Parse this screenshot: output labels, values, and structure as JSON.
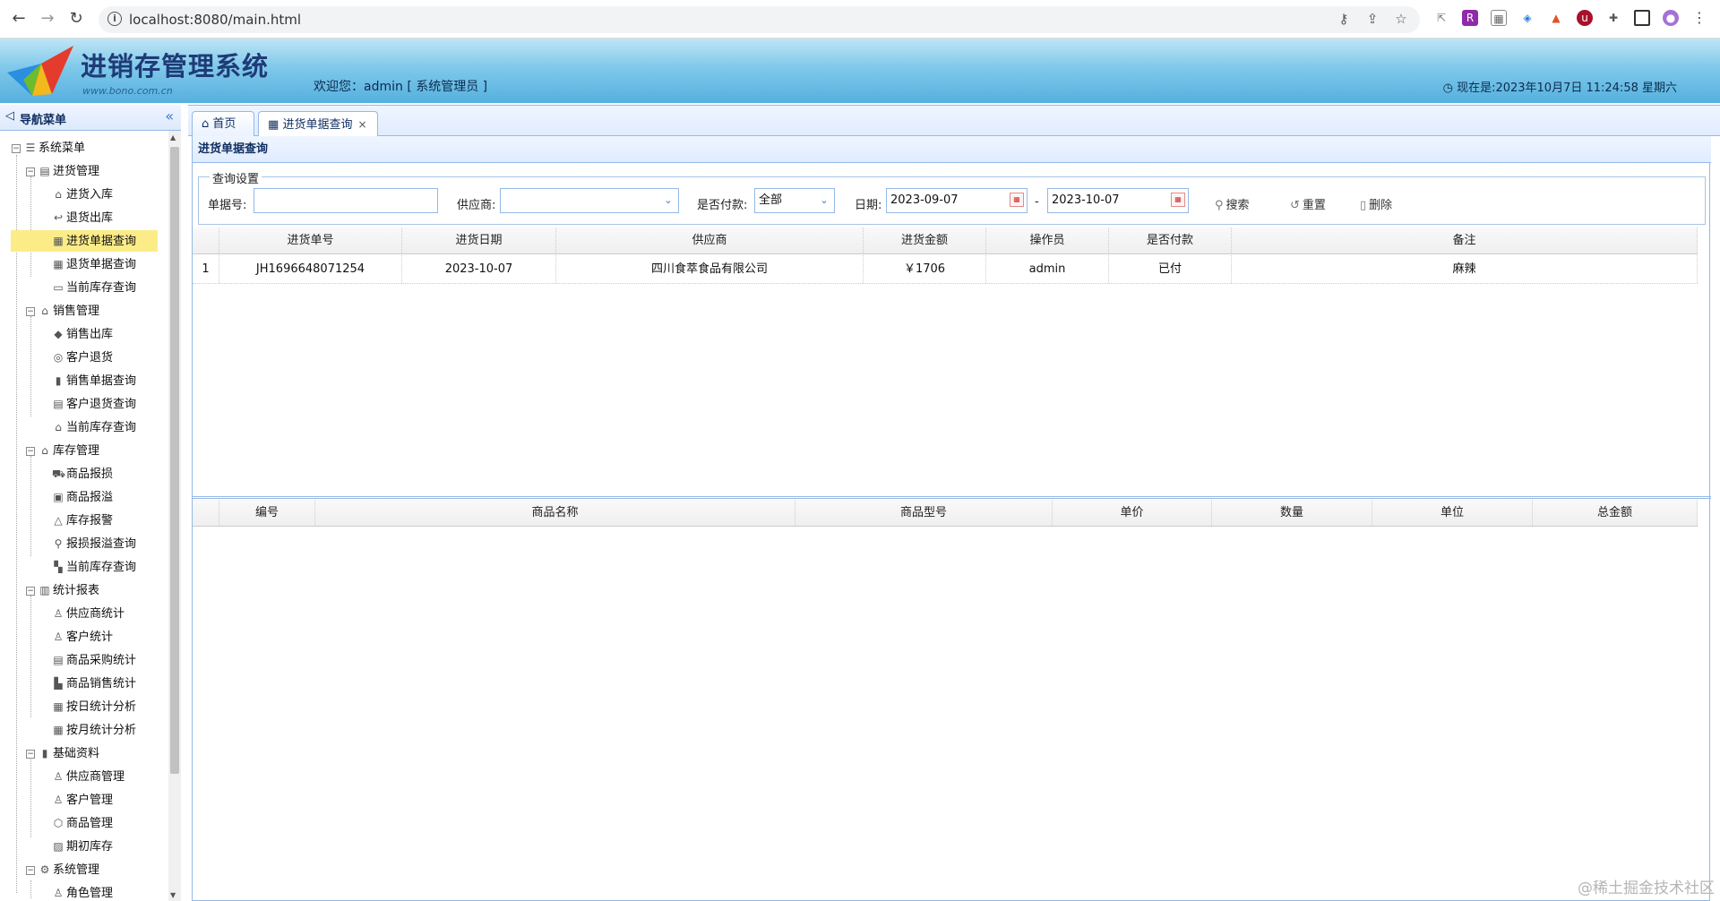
{
  "browser": {
    "url": "localhost:8080/main.html"
  },
  "header": {
    "title": "进销存管理系统",
    "subtitle": "www.bono.com.cn",
    "welcome": "欢迎您：admin [ 系统管理员 ]",
    "clock": "现在是:2023年10月7日 11:24:58 星期六"
  },
  "sidebar": {
    "title": "导航菜单",
    "root": "系统菜单",
    "groups": [
      {
        "label": "进货管理",
        "items": [
          "进货入库",
          "退货出库",
          "进货单据查询",
          "退货单据查询",
          "当前库存查询"
        ]
      },
      {
        "label": "销售管理",
        "items": [
          "销售出库",
          "客户退货",
          "销售单据查询",
          "客户退货查询",
          "当前库存查询"
        ]
      },
      {
        "label": "库存管理",
        "items": [
          "商品报损",
          "商品报溢",
          "库存报警",
          "报损报溢查询",
          "当前库存查询"
        ]
      },
      {
        "label": "统计报表",
        "items": [
          "供应商统计",
          "客户统计",
          "商品采购统计",
          "商品销售统计",
          "按日统计分析",
          "按月统计分析"
        ]
      },
      {
        "label": "基础资料",
        "items": [
          "供应商管理",
          "客户管理",
          "商品管理",
          "期初库存"
        ]
      },
      {
        "label": "系统管理",
        "items": [
          "角色管理"
        ]
      }
    ],
    "selected": "进货单据查询"
  },
  "tabs": [
    {
      "label": "首页"
    },
    {
      "label": "进货单据查询"
    }
  ],
  "panel": {
    "title": "进货单据查询",
    "legend": "查询设置",
    "fields": {
      "bill_no_label": "单据号:",
      "bill_no_value": "",
      "supplier_label": "供应商:",
      "supplier_value": "",
      "paid_label": "是否付款:",
      "paid_value": "全部",
      "date_label": "日期:",
      "date_from": "2023-09-07",
      "date_sep": "-",
      "date_to": "2023-10-07"
    },
    "buttons": {
      "search": "搜索",
      "reset": "重置",
      "delete": "删除"
    }
  },
  "bill_grid": {
    "headers": [
      "进货单号",
      "进货日期",
      "供应商",
      "进货金额",
      "操作员",
      "是否付款",
      "备注"
    ],
    "rows": [
      {
        "index": "1",
        "no": "JH1696648071254",
        "date": "2023-10-07",
        "supplier": "四川食萃食品有限公司",
        "amount": "￥1706",
        "operator": "admin",
        "paid": "已付",
        "remark": "麻辣"
      }
    ]
  },
  "item_grid": {
    "headers": [
      "编号",
      "商品名称",
      "商品型号",
      "单价",
      "数量",
      "单位",
      "总金额"
    ]
  },
  "watermark": "@稀土掘金技术社区"
}
